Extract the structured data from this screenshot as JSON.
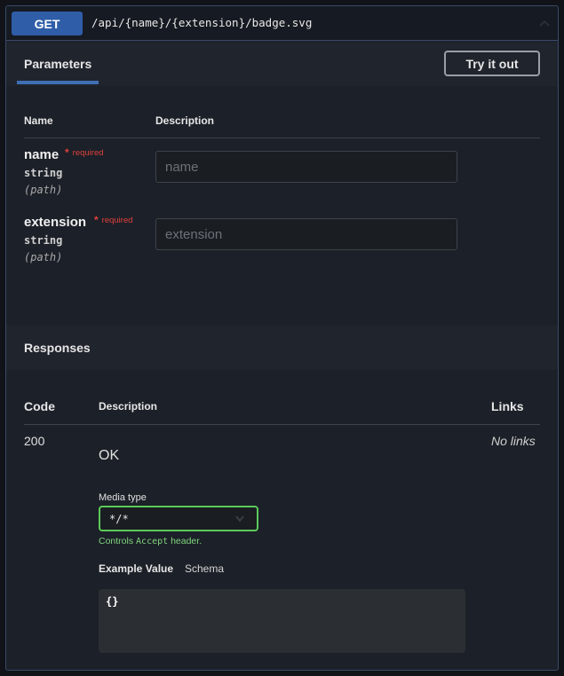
{
  "operation": {
    "method": "GET",
    "path": "/api/{name}/{extension}/badge.svg"
  },
  "parameters": {
    "tab_label": "Parameters",
    "try_it_out_label": "Try it out",
    "col_name": "Name",
    "col_description": "Description",
    "items": [
      {
        "name": "name",
        "required_star": "*",
        "required_label": "required",
        "type": "string",
        "in": "(path)",
        "placeholder": "name"
      },
      {
        "name": "extension",
        "required_star": "*",
        "required_label": "required",
        "type": "string",
        "in": "(path)",
        "placeholder": "extension"
      }
    ]
  },
  "responses": {
    "title": "Responses",
    "col_code": "Code",
    "col_description": "Description",
    "col_links": "Links",
    "rows": [
      {
        "code": "200",
        "description": "OK",
        "links": "No links",
        "media_type_label": "Media type",
        "media_type_value": "*/*",
        "controls_prefix": "Controls",
        "controls_code": "Accept",
        "controls_suffix": "header.",
        "example_tab": "Example Value",
        "schema_tab": "Schema",
        "example_body": "{}"
      }
    ]
  },
  "colors": {
    "method_badge": "#2f5da8",
    "border_accent": "#3a4a6b",
    "required": "#e0413b",
    "media_select_border": "#5cc95a",
    "controls_text": "#7fd47d"
  }
}
